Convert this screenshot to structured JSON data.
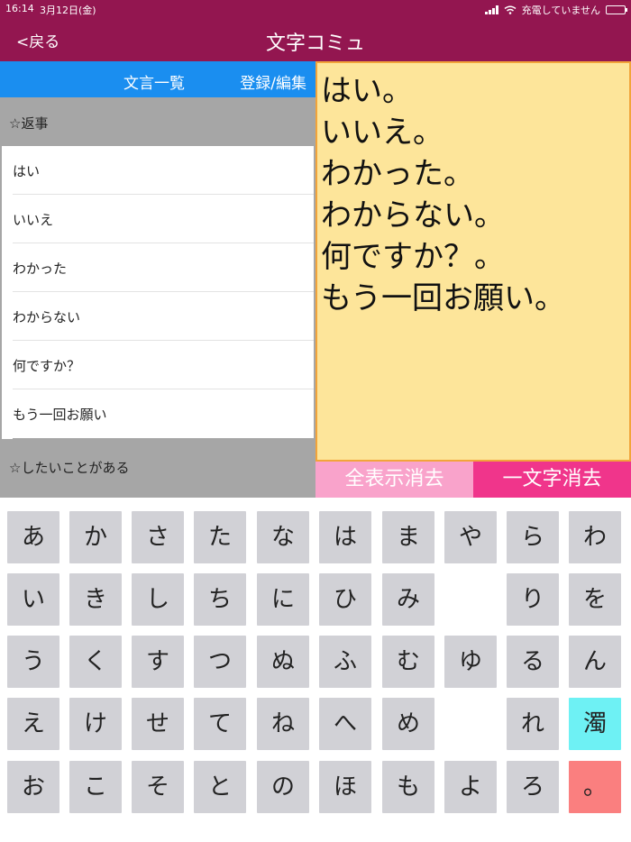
{
  "status_bar": {
    "time": "16:14",
    "date": "3月12日(金)",
    "charging_text": "充電していません",
    "icons": [
      "signal-icon",
      "wifi-icon",
      "battery-icon"
    ]
  },
  "nav": {
    "back_label": "<戻る",
    "title": "文字コミュ"
  },
  "phrase_panel": {
    "header_title": "文言一覧",
    "edit_label": "登録/編集",
    "sections": [
      {
        "title": "☆返事",
        "items": [
          "はい",
          "いいえ",
          "わかった",
          "わからない",
          "何ですか？",
          "もう一回お願い"
        ]
      },
      {
        "title": "☆したいことがある",
        "items": []
      }
    ]
  },
  "display": {
    "lines": [
      "はい。",
      "いいえ。",
      "わかった。",
      "わからない。",
      "何ですか？。",
      "もう一回お願い。"
    ]
  },
  "buttons": {
    "clear_all": "全表示消去",
    "delete_one": "一文字消去"
  },
  "keyboard": {
    "columns": [
      [
        "あ",
        "い",
        "う",
        "え",
        "お"
      ],
      [
        "か",
        "き",
        "く",
        "け",
        "こ"
      ],
      [
        "さ",
        "し",
        "す",
        "せ",
        "そ"
      ],
      [
        "た",
        "ち",
        "つ",
        "て",
        "と"
      ],
      [
        "な",
        "に",
        "ぬ",
        "ね",
        "の"
      ],
      [
        "は",
        "ひ",
        "ふ",
        "へ",
        "ほ"
      ],
      [
        "ま",
        "み",
        "む",
        "め",
        "も"
      ],
      [
        "や",
        "",
        "ゆ",
        "",
        "よ"
      ],
      [
        "ら",
        "り",
        "る",
        "れ",
        "ろ"
      ],
      [
        "わ",
        "を",
        "ん",
        "濁",
        "。"
      ]
    ],
    "colors": {
      "key": "#d1d1d6",
      "dakuten": "#6ef1f4",
      "maru": "#fa7f7f"
    }
  },
  "colors": {
    "brand": "#931650",
    "header_blue": "#1a8ef0",
    "display_bg": "#fde59a",
    "clear_all_bg": "#f9a3cb",
    "delete_one_bg": "#f0358b"
  }
}
